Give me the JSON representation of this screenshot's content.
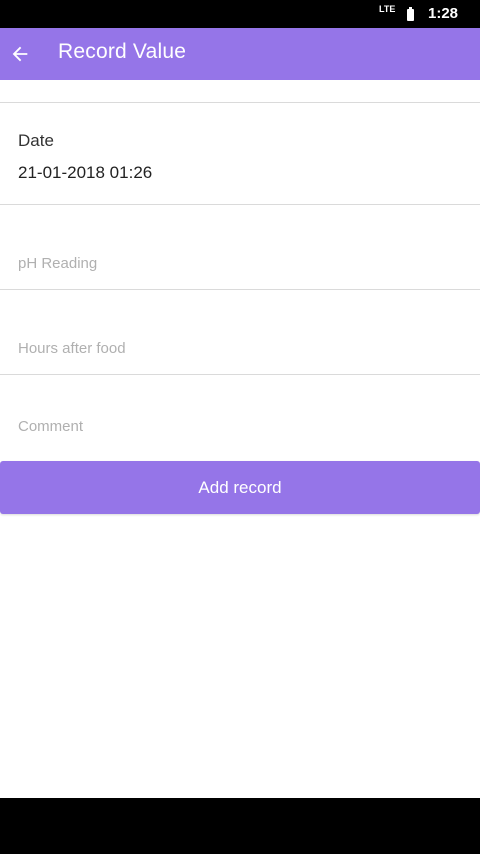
{
  "status_bar": {
    "network": "LTE",
    "time": "1:28"
  },
  "app_bar": {
    "title": "Record Value",
    "back_icon": "arrow-left-icon"
  },
  "form": {
    "date_label": "Date",
    "date_value": "21-01-2018 01:26",
    "ph_reading": {
      "value": "",
      "placeholder": "pH Reading"
    },
    "hours_after_food": {
      "value": "",
      "placeholder": "Hours after food"
    },
    "comment": {
      "value": "",
      "placeholder": "Comment"
    },
    "submit_label": "Add record"
  },
  "colors": {
    "accent": "#9575e8",
    "divider": "#dadada",
    "placeholder": "#b0b0b0"
  }
}
